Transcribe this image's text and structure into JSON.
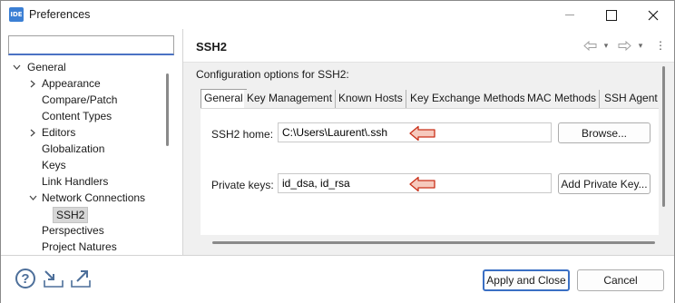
{
  "window": {
    "title": "Preferences",
    "app_icon_text": "IDE"
  },
  "filter": {
    "value": "",
    "placeholder": ""
  },
  "tree": [
    {
      "label": "General",
      "expanded": true,
      "level": 0
    },
    {
      "label": "Appearance",
      "expanded": false,
      "level": 1,
      "has_children": true
    },
    {
      "label": "Compare/Patch",
      "level": 1
    },
    {
      "label": "Content Types",
      "level": 1
    },
    {
      "label": "Editors",
      "expanded": false,
      "level": 1,
      "has_children": true
    },
    {
      "label": "Globalization",
      "level": 1
    },
    {
      "label": "Keys",
      "level": 1
    },
    {
      "label": "Link Handlers",
      "level": 1
    },
    {
      "label": "Network Connections",
      "expanded": true,
      "level": 1,
      "has_children": true
    },
    {
      "label": "SSH2",
      "level": 2,
      "selected": true
    },
    {
      "label": "Perspectives",
      "level": 1
    },
    {
      "label": "Project Natures",
      "level": 1
    }
  ],
  "page": {
    "title": "SSH2",
    "description": "Configuration options for SSH2:"
  },
  "tabs": [
    {
      "label": "General",
      "active": true
    },
    {
      "label": "Key Management"
    },
    {
      "label": "Known Hosts"
    },
    {
      "label": "Key Exchange Methods"
    },
    {
      "label": "MAC Methods"
    },
    {
      "label": "SSH Agent"
    }
  ],
  "general": {
    "ssh2_home_label": "SSH2 home:",
    "ssh2_home_value": "C:\\Users\\Laurent\\.ssh",
    "browse_label": "Browse...",
    "private_keys_label": "Private keys:",
    "private_keys_value": "id_dsa, id_rsa",
    "add_private_key_label": "Add Private Key..."
  },
  "footer": {
    "apply_close_label": "Apply and Close",
    "cancel_label": "Cancel"
  },
  "colors": {
    "accent": "#3a6fc4",
    "callout_fill": "#f6c9bd",
    "callout_stroke": "#c9301a",
    "content_bg": "#f0f0f0"
  }
}
